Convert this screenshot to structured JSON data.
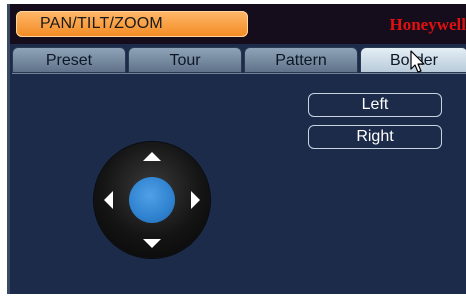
{
  "window": {
    "title": "PAN/TILT/ZOOM",
    "brand": "Honeywell"
  },
  "tabs": [
    {
      "label": "Preset",
      "active": false
    },
    {
      "label": "Tour",
      "active": false
    },
    {
      "label": "Pattern",
      "active": false
    },
    {
      "label": "Border",
      "active": true
    }
  ],
  "border_panel": {
    "left_button": "Left",
    "right_button": "Right"
  },
  "colors": {
    "title_pill": "#f28a22",
    "brand": "#e01010",
    "background": "#1c2b4a",
    "dpad_center": "#2f82cf"
  },
  "icons": {
    "dpad_up": "arrow-up-icon",
    "dpad_down": "arrow-down-icon",
    "dpad_left": "arrow-left-icon",
    "dpad_right": "arrow-right-icon",
    "cursor": "mouse-pointer-icon"
  }
}
